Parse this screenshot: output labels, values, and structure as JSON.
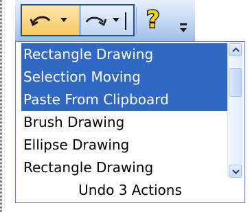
{
  "undo_history": {
    "items": [
      {
        "label": "Rectangle Drawing",
        "selected": true
      },
      {
        "label": "Selection Moving",
        "selected": true
      },
      {
        "label": "Paste From Clipboard",
        "selected": true
      },
      {
        "label": "Brush Drawing",
        "selected": false
      },
      {
        "label": "Ellipse Drawing",
        "selected": false
      },
      {
        "label": "Rectangle Drawing",
        "selected": false
      }
    ],
    "footer": "Undo 3 Actions"
  },
  "toolbar": {
    "icons": [
      "undo-icon",
      "redo-icon",
      "help-icon",
      "overflow-icon"
    ],
    "help_glyph": "?"
  },
  "colors": {
    "selection": "#3168c6",
    "toolbar_border": "#1f4f9f",
    "active_button": "#f9c861"
  }
}
